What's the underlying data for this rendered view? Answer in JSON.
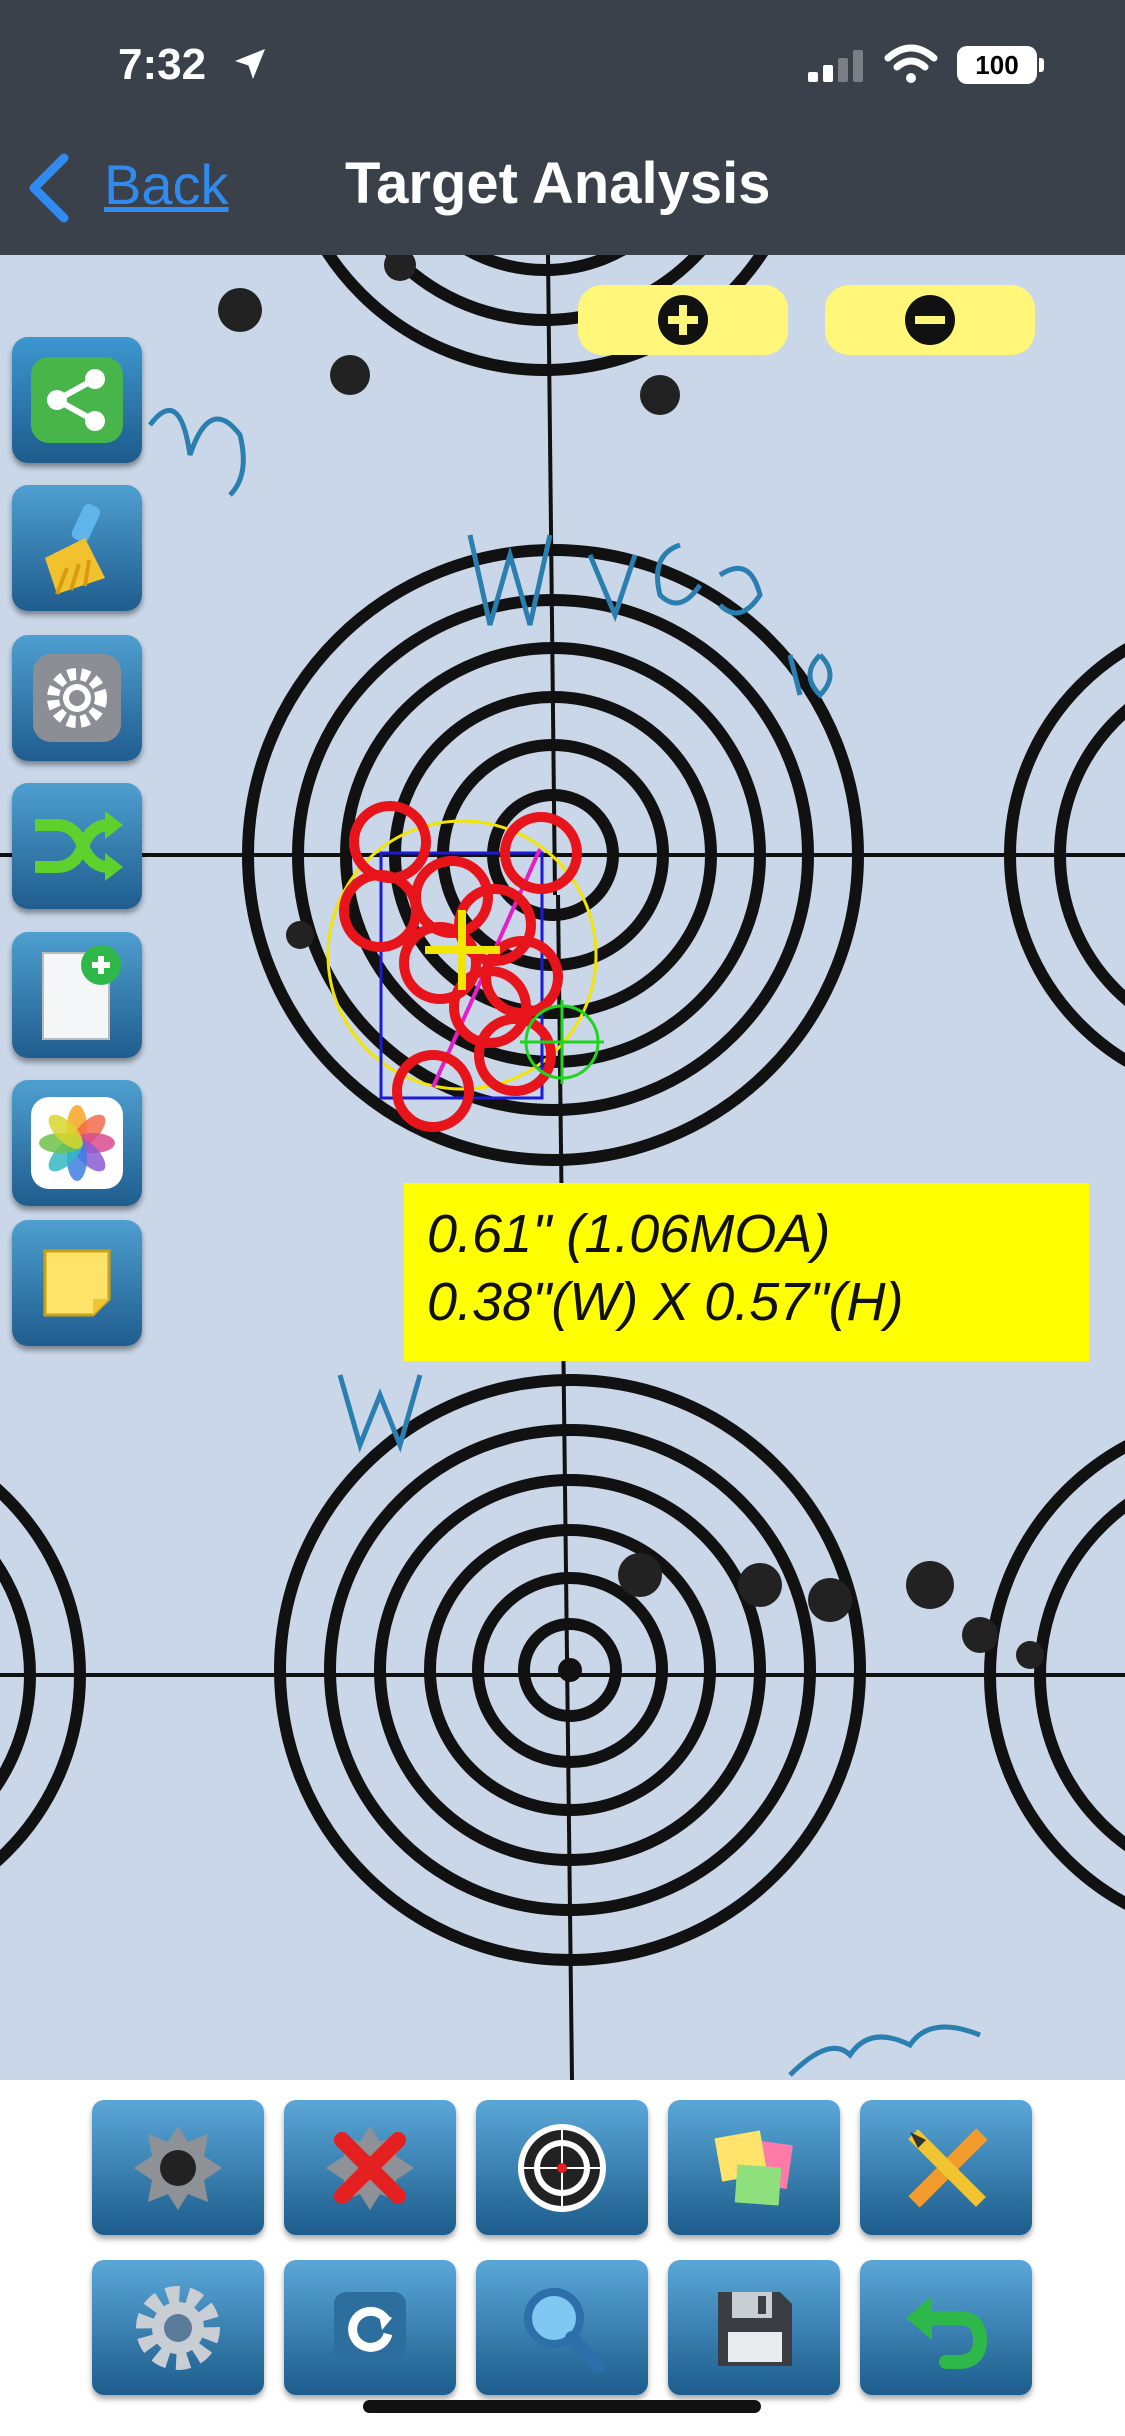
{
  "status": {
    "time": "7:32",
    "battery": "100"
  },
  "nav": {
    "back_label": "Back",
    "title": "Target Analysis"
  },
  "icons": {
    "status": [
      "location-arrow-icon",
      "signal-icon",
      "wifi-icon",
      "battery-icon"
    ],
    "side": [
      "share-icon",
      "clear-icon",
      "settings-icon",
      "shuffle-icon",
      "new-document-icon",
      "photos-icon",
      "note-icon"
    ],
    "toolbar": [
      "bullet-hole-icon",
      "delete-hole-icon",
      "target-icon",
      "sticky-notes-icon",
      "measure-tools-icon",
      "settings-gear-icon",
      "refresh-icon",
      "magnifier-icon",
      "save-icon",
      "undo-icon"
    ]
  },
  "target": {
    "group_size": "0.61\" (1.06MOA)",
    "group_dims": "0.38\"(W) X 0.57\"(H)",
    "shots_marked": 9
  },
  "colors": {
    "accent": "#2f8bf0",
    "header": "#3b414b",
    "result_bg": "#ffff00",
    "zoom_bg": "#fff67a",
    "shot_ring": "#e8141c"
  }
}
